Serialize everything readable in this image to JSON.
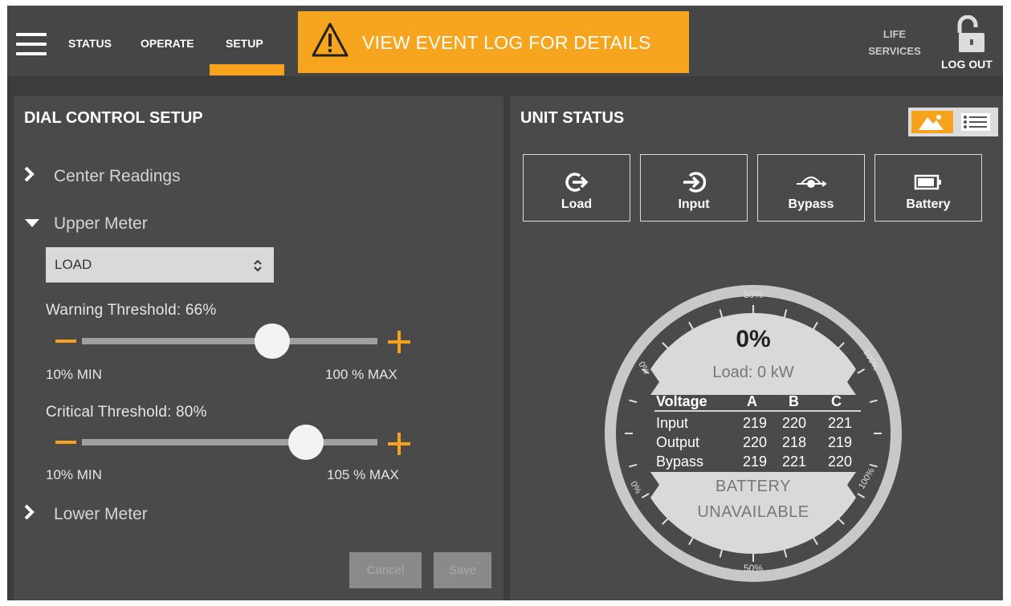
{
  "header": {
    "menu_icon": "hamburger-icon",
    "tabs": [
      {
        "label": "STATUS"
      },
      {
        "label": "OPERATE"
      },
      {
        "label": "SETUP"
      }
    ],
    "active_tab": "SETUP",
    "alert": {
      "icon": "warning-icon",
      "text": "VIEW EVENT LOG FOR DETAILS",
      "color": "#f7a51e"
    },
    "life_services_line1": "LIFE",
    "life_services_line2": "SERVICES",
    "lock_icon": "unlocked-padlock-icon",
    "logout_label": "LOG OUT"
  },
  "dial_setup": {
    "title": "DIAL CONTROL SETUP",
    "center_readings": "Center Readings",
    "upper_meter": "Upper Meter",
    "upper_select_value": "LOAD",
    "warning_label": "Warning Threshold: 66%",
    "warning_level": 66,
    "warning_min": "10% MIN",
    "warning_max": "100 % MAX",
    "critical_label": "Critical Threshold: 80%",
    "critical_level": 80,
    "critical_min": "10% MIN",
    "critical_max": "105 % MAX",
    "lower_meter": "Lower Meter",
    "cancel_label": "Cancel",
    "save_label": "Save"
  },
  "unit_status": {
    "title": "UNIT STATUS",
    "view_icons": [
      "graphic-view-icon",
      "list-view-icon"
    ],
    "buttons": [
      {
        "label": "Load",
        "icon": "load-arrow-icon"
      },
      {
        "label": "Input",
        "icon": "input-arrow-icon"
      },
      {
        "label": "Bypass",
        "icon": "bypass-icon"
      },
      {
        "label": "Battery",
        "icon": "battery-icon"
      }
    ],
    "dial": {
      "percent": "0%",
      "load_text": "Load: 0 kW",
      "top_mark": "50%",
      "bottom_mark": "50%",
      "left_top_mark": "0%",
      "right_top_mark": "100%",
      "left_bottom_mark": "0%",
      "right_bottom_mark": "100%",
      "table_headers": [
        "Voltage",
        "A",
        "B",
        "C"
      ],
      "rows": [
        {
          "name": "Input",
          "a": "219",
          "b": "220",
          "c": "221"
        },
        {
          "name": "Output",
          "a": "220",
          "b": "218",
          "c": "219"
        },
        {
          "name": "Bypass",
          "a": "219",
          "b": "221",
          "c": "220"
        }
      ],
      "battery_line1": "BATTERY",
      "battery_line2": "UNAVAILABLE"
    }
  }
}
